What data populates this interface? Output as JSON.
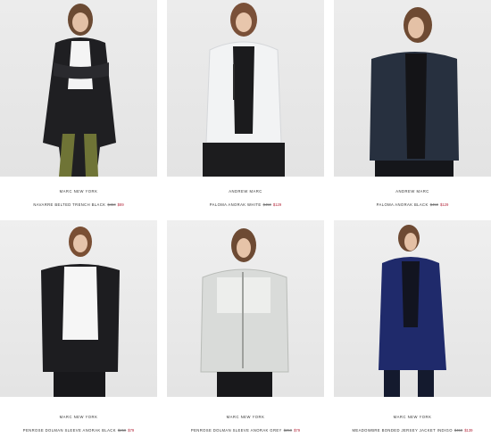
{
  "products": [
    {
      "brand": "MARC NEW YORK",
      "name": "NAVARRE BELTED TRENCH BLACK",
      "was_price": "$450",
      "sale_price": "$89",
      "image": "model-black-trench"
    },
    {
      "brand": "ANDREW MARC",
      "name": "PALOMA ANORAK WHITE",
      "was_price": "$450",
      "sale_price": "$129",
      "image": "model-white-anorak"
    },
    {
      "brand": "ANDREW MARC",
      "name": "PALOMA ANORAK BLACK",
      "was_price": "$450",
      "sale_price": "$129",
      "image": "model-navy-anorak"
    },
    {
      "brand": "MARC NEW YORK",
      "name": "PENROSE DOLMAN SLEEVE ANORAK BLACK",
      "was_price": "$250",
      "sale_price": "$79",
      "image": "model-black-anorak"
    },
    {
      "brand": "MARC NEW YORK",
      "name": "PENROSE DOLMAN SLEEVE ANORAK GREY",
      "was_price": "$250",
      "sale_price": "$79",
      "image": "model-grey-anorak"
    },
    {
      "brand": "MARC NEW YORK",
      "name": "MEADOWBRE BONDED JERSEY JACKET INDIGO",
      "was_price": "$450",
      "sale_price": "$139",
      "image": "model-indigo-jacket"
    }
  ],
  "colors": {
    "sale": "#b3263a",
    "text": "#333333",
    "photo_bg": "#e6e6e6"
  }
}
